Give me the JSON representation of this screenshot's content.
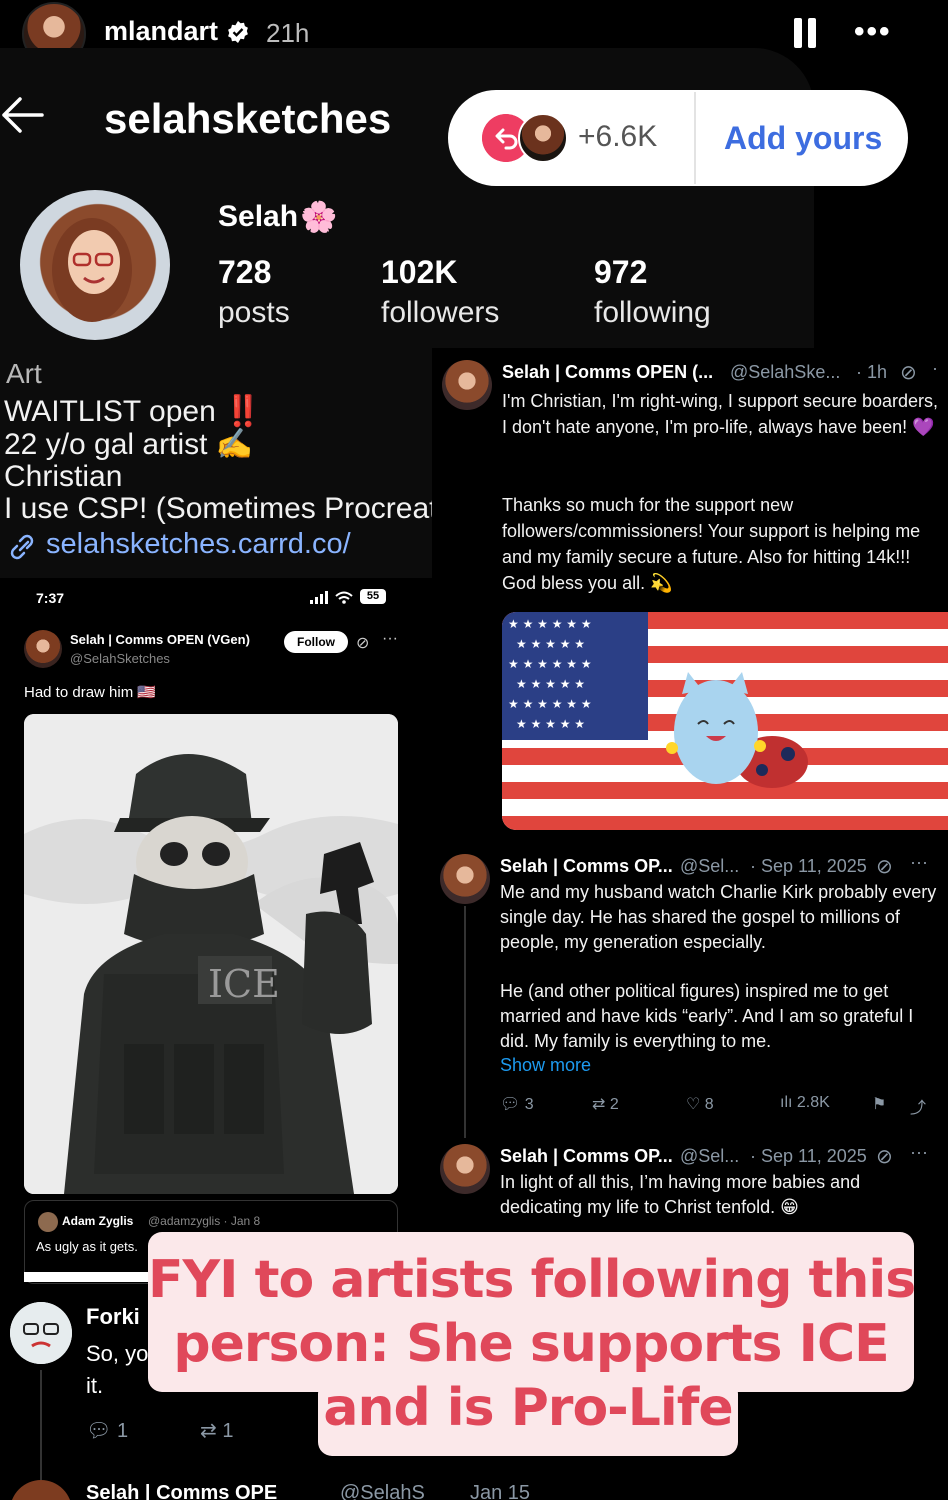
{
  "story": {
    "username": "mlandart",
    "time": "21h",
    "more": "•••"
  },
  "profile": {
    "handle": "selahsketches",
    "add_yours": {
      "count": "+6.6K",
      "label": "Add yours"
    },
    "name": "Selah",
    "name_emoji": "🌸",
    "stats": [
      {
        "value": "728",
        "label": "posts"
      },
      {
        "value": "102K",
        "label": "followers"
      },
      {
        "value": "972",
        "label": "following"
      }
    ],
    "bio": {
      "category": "Art",
      "lines": [
        "WAITLIST open ‼️",
        "22 y/o gal artist ✍️",
        "Christian",
        "I use CSP! (Sometimes Procreate"
      ],
      "link": "selahsketches.carrd.co/"
    }
  },
  "phone": {
    "time": "7:37",
    "status": "55",
    "post": {
      "name": "Selah | Comms OPEN (VGen)",
      "handle": "@SelahSketches",
      "follow_label": "Follow",
      "text": "Had to draw him 🇺🇸",
      "art_label": "ICE"
    },
    "quote": {
      "name": "Adam Zyglis",
      "meta": "@adamzyglis · Jan 8",
      "text": "As ugly as it gets."
    },
    "reply": {
      "name": "Forki",
      "text_1": "So, yo",
      "text_2": "it.",
      "reply_count": "1",
      "retweet_count": "1"
    },
    "bottom": {
      "name": "Selah | Comms OPE",
      "handle": "@SelahS",
      "date": "Jan 15"
    }
  },
  "tweets": [
    {
      "name": "Selah | Comms OPEN (...",
      "handle": "@SelahSke...",
      "date": "· 1h",
      "paragraphs": [
        "I'm Christian, I'm right-wing, I support secure boarders, I don't hate anyone, I'm pro-life, always have been! 💜",
        "Thanks so much for the support new followers/commissioners! Your support is helping me and my family secure a future. Also for hitting 14k!!! God bless you all. 💫"
      ]
    },
    {
      "name": "Selah | Comms OP...",
      "handle": "@Sel...",
      "date": "· Sep 11, 2025",
      "paragraphs": [
        "Me and my husband watch Charlie Kirk probably every single day. He has shared the gospel to millions of people, my generation especially.",
        "He (and other political figures) inspired me to get married and have kids “early”. And I am so grateful I did. My family is everything to me."
      ],
      "show_more": "Show more",
      "stats": {
        "replies": "3",
        "retweets": "2",
        "likes": "8",
        "views": "2.8K"
      }
    },
    {
      "name": "Selah | Comms OP...",
      "handle": "@Sel...",
      "date": "· Sep 11, 2025",
      "paragraphs": [
        "In light of all this, I’m having more babies and dedicating my life to Christ tenfold. 😁"
      ]
    }
  ],
  "caption": {
    "line1": "FYI to artists following this",
    "line2": "person: She supports ICE",
    "line3": "and is Pro-Life"
  },
  "colors": {
    "caption_text": "#e0485a",
    "caption_bg": "#fbe8ea",
    "link": "#8ab4ff",
    "add_yours": "#3d6de0",
    "share_icon": "#ee3d62",
    "muted": "#8b98a5"
  }
}
